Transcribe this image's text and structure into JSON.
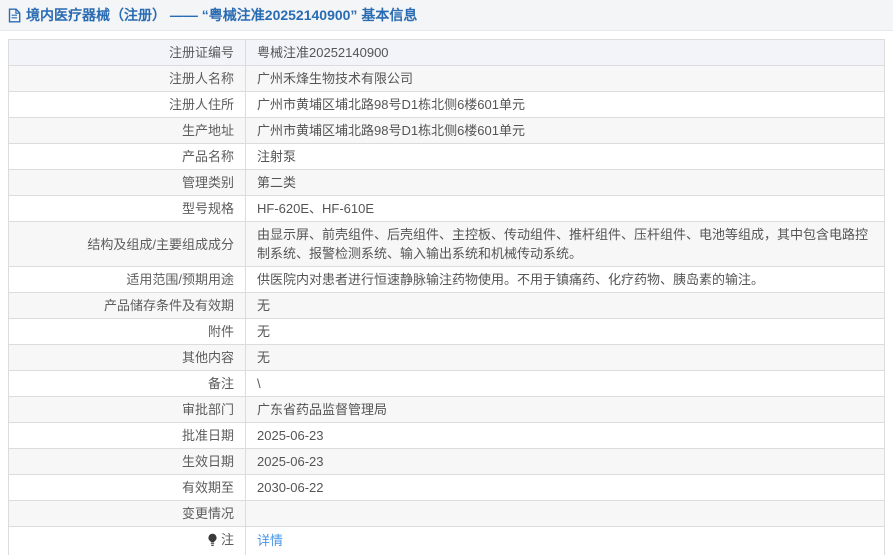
{
  "header": {
    "icon": "document-icon",
    "full_title": "境内医疗器械（注册）  ——  “粤械注准20252140900”  基本信息"
  },
  "colors": {
    "header_text_blue": "#2a6cb3",
    "link_blue": "#4795e5",
    "row_highlight": "#f2f4fa",
    "row_stripe_gray": "#f7f7f7",
    "border_gray": "#dcdcdc"
  },
  "table": {
    "rows": [
      {
        "label": "注册证编号",
        "value": "粤械注准20252140900"
      },
      {
        "label": "注册人名称",
        "value": "广州禾烽生物技术有限公司"
      },
      {
        "label": "注册人住所",
        "value": "广州市黄埔区埔北路98号D1栋北侧6楼601单元"
      },
      {
        "label": "生产地址",
        "value": "广州市黄埔区埔北路98号D1栋北侧6楼601单元"
      },
      {
        "label": "产品名称",
        "value": "注射泵"
      },
      {
        "label": "管理类别",
        "value": "第二类"
      },
      {
        "label": "型号规格",
        "value": "HF-620E、HF-610E"
      },
      {
        "label": "结构及组成/主要组成成分",
        "value": "由显示屏、前壳组件、后壳组件、主控板、传动组件、推杆组件、压杆组件、电池等组成，其中包含电路控制系统、报警检测系统、输入输出系统和机械传动系统。"
      },
      {
        "label": "适用范围/预期用途",
        "value": "供医院内对患者进行恒速静脉输注药物使用。不用于镇痛药、化疗药物、胰岛素的输注。"
      },
      {
        "label": "产品储存条件及有效期",
        "value": "无"
      },
      {
        "label": "附件",
        "value": "无"
      },
      {
        "label": "其他内容",
        "value": "无"
      },
      {
        "label": "备注",
        "value": "\\"
      },
      {
        "label": "审批部门",
        "value": "广东省药品监督管理局"
      },
      {
        "label": "批准日期",
        "value": "2025-06-23"
      },
      {
        "label": "生效日期",
        "value": "2025-06-23"
      },
      {
        "label": "有效期至",
        "value": "2030-06-22"
      },
      {
        "label": "变更情况",
        "value": ""
      },
      {
        "label": "注",
        "label_icon": "bulb-icon",
        "value": "详情",
        "link": true
      }
    ]
  }
}
